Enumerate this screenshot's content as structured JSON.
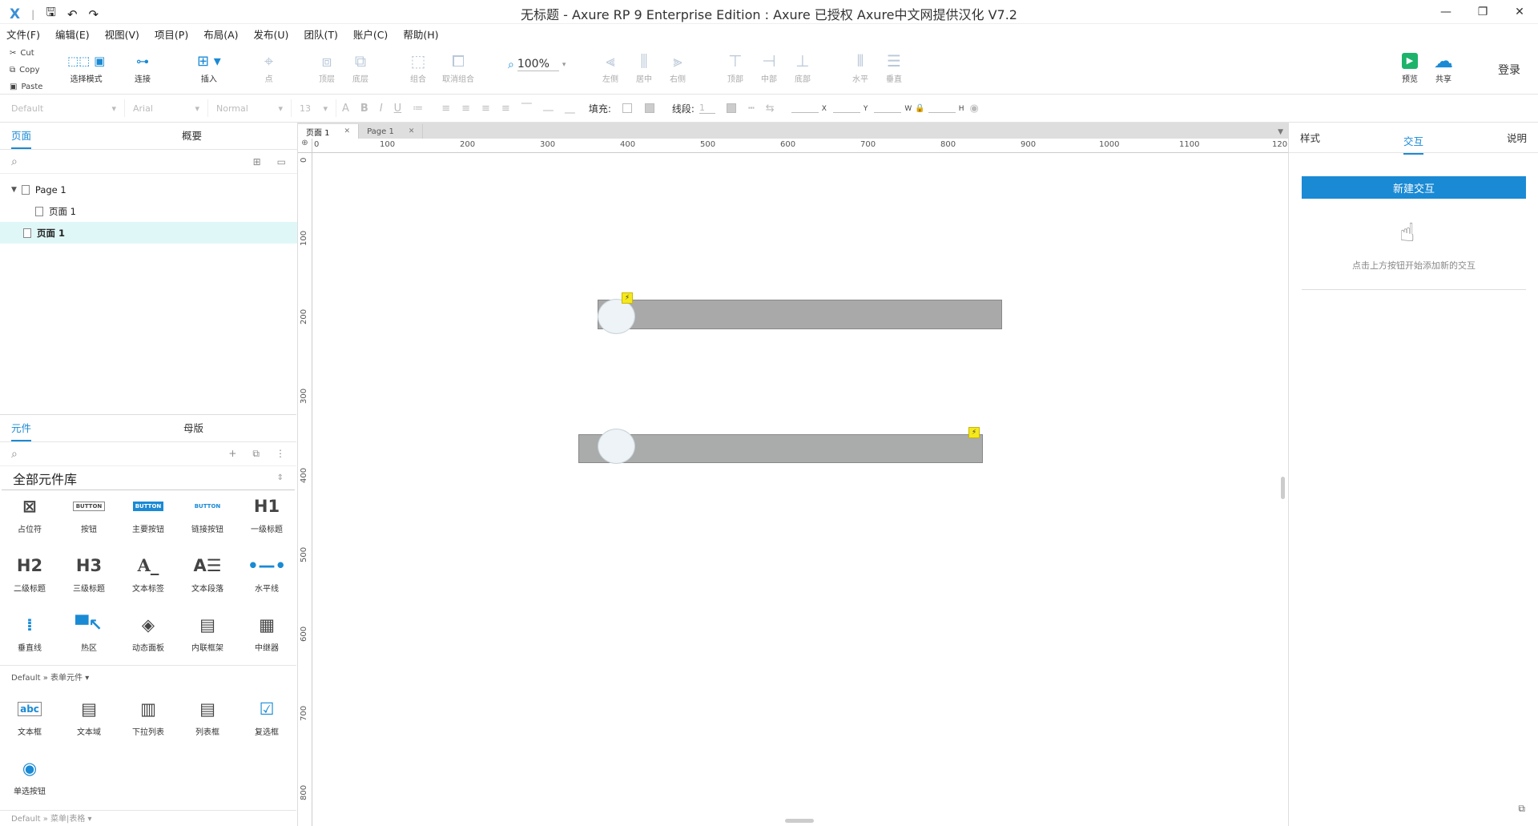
{
  "window": {
    "title": "无标题 - Axure RP 9 Enterprise Edition : Axure 已授权    Axure中文网提供汉化 V7.2",
    "minimize": "—",
    "restore": "❐",
    "close": "✕"
  },
  "menu": [
    "文件(F)",
    "编辑(E)",
    "视图(V)",
    "项目(P)",
    "布局(A)",
    "发布(U)",
    "团队(T)",
    "账户(C)",
    "帮助(H)"
  ],
  "toolbar": {
    "clipboard": {
      "cut": "Cut",
      "copy": "Copy",
      "paste": "Paste"
    },
    "select_mode": "选择模式",
    "connect": "连接",
    "insert": "插入",
    "point": "点",
    "top": "顶层",
    "bottom": "底层",
    "group": "组合",
    "ungroup": "取消组合",
    "zoom": "100%",
    "align_left": "左侧",
    "align_center": "居中",
    "align_right": "右侧",
    "align_top": "顶部",
    "align_middle": "中部",
    "align_bottom": "底部",
    "distribute_h": "水平",
    "distribute_v": "垂直",
    "preview": "预览",
    "share": "共享",
    "login": "登录"
  },
  "formatbar": {
    "style": "Default",
    "font": "Arial",
    "weight": "Normal",
    "size": "13",
    "fill_label": "填充:",
    "line_label": "线段:",
    "line_value": "1",
    "x_label": "X",
    "y_label": "Y",
    "w_label": "W",
    "h_label": "H"
  },
  "left_panel": {
    "tabs": {
      "pages": "页面",
      "outline": "概要"
    },
    "tree": [
      {
        "label": "Page 1",
        "level": 0
      },
      {
        "label": "页面 1",
        "level": 1
      },
      {
        "label": "页面 1",
        "level": 0,
        "selected": true
      }
    ],
    "lib_tabs": {
      "widgets": "元件",
      "masters": "母版"
    },
    "library_name": "全部元件库",
    "widgets_row1": [
      "占位符",
      "按钮",
      "主要按钮",
      "链接按钮",
      "一级标题"
    ],
    "widgets_row2": [
      "二级标题",
      "三级标题",
      "文本标签",
      "文本段落",
      "水平线"
    ],
    "widgets_row3": [
      "垂直线",
      "热区",
      "动态面板",
      "内联框架",
      "中继器"
    ],
    "form_section": "Default » 表单元件 ▾",
    "form_row1": [
      "文本框",
      "文本域",
      "下拉列表",
      "列表框",
      "复选框"
    ],
    "form_row2": [
      "单选按钮"
    ],
    "next_section": "Default » 菜单|表格 ▾"
  },
  "canvas": {
    "tabs": [
      {
        "label": "页面 1",
        "active": true
      },
      {
        "label": "Page 1",
        "active": false
      }
    ],
    "h_ruler": [
      "0",
      "100",
      "200",
      "300",
      "400",
      "500",
      "600",
      "700",
      "800",
      "900",
      "1000",
      "1100",
      "120"
    ],
    "v_ruler": [
      "0",
      "100",
      "200",
      "300",
      "400",
      "500",
      "600",
      "700",
      "800"
    ]
  },
  "right_panel": {
    "tabs": {
      "style": "样式",
      "interactions": "交互",
      "notes": "说明"
    },
    "new_interaction": "新建交互",
    "hint": "点击上方按钮开始添加新的交互"
  }
}
